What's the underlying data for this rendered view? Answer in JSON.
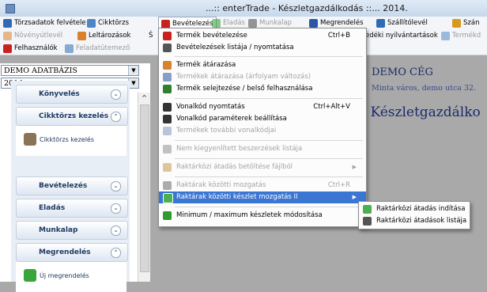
{
  "window": {
    "title": "...:: enterTrade - Készletgazdálkodás ::... 2014."
  },
  "menubar": {
    "row1": [
      {
        "label": "Törzsadatok felvétele",
        "icon": "database-icon",
        "color": "#2d6bb5",
        "disabled": false
      },
      {
        "label": "Cikktörzs",
        "icon": "list-icon",
        "color": "#4f86c6",
        "disabled": false
      },
      {
        "label": "Bevételezés",
        "icon": "inbound-arrow-icon",
        "color": "#c8221f",
        "disabled": false,
        "active": true
      },
      {
        "label": "Eladás",
        "icon": "outbound-arrow-icon",
        "color": "#2f9a2f",
        "disabled": true
      },
      {
        "label": "Munkalap",
        "icon": "hammer-icon",
        "color": "#444444",
        "disabled": true
      },
      {
        "label": "Megrendelés",
        "icon": "order-icon",
        "color": "#2b58a6",
        "disabled": false
      },
      {
        "label": "Szállítólevél",
        "icon": "delivery-note-icon",
        "color": "#2d6bb5",
        "disabled": false
      },
      {
        "label": "Szán",
        "icon": "invoice-icon",
        "color": "#d69a1e",
        "disabled": false
      }
    ],
    "row2": [
      {
        "label": "Növényútlevél",
        "icon": "leaf-icon",
        "color": "#d9812d",
        "disabled": true
      },
      {
        "label": "Leltározások",
        "icon": "inventory-icon",
        "color": "#d9812d",
        "disabled": false
      },
      {
        "label": "Ś",
        "icon": "",
        "color": "#444444",
        "disabled": false
      },
      {
        "label": "edéki nyilvántartások",
        "icon": "",
        "color": "#444444",
        "disabled": false
      },
      {
        "label": "Termékd",
        "icon": "product-icon",
        "color": "#4f86c6",
        "disabled": true
      }
    ],
    "row3": [
      {
        "label": "Felhasználók",
        "icon": "user-icon",
        "color": "#c8221f",
        "disabled": false
      },
      {
        "label": "Feladatütemező",
        "icon": "scheduler-icon",
        "color": "#2d6bb5",
        "disabled": true
      }
    ]
  },
  "left": {
    "database_select": "DEMO ADATBÁZIS",
    "year_select": "2014"
  },
  "nav": {
    "sections": [
      {
        "label": "Könyvelés",
        "expanded": false
      },
      {
        "label": "Cikktörzs kezelés",
        "expanded": true,
        "item": "Cikktörzs kezelés"
      },
      {
        "label": "Bevételezés",
        "expanded": false
      },
      {
        "label": "Eladás",
        "expanded": false
      },
      {
        "label": "Munkalap",
        "expanded": false
      },
      {
        "label": "Megrendelés",
        "expanded": true,
        "item": "Új megrendelés"
      }
    ]
  },
  "content": {
    "company": "DEMO CÉG",
    "address": "Minta város, demo utca 32.",
    "heading": "e Készletgazdálko"
  },
  "dropdown": {
    "items": [
      {
        "label": "Termék bevételezése",
        "shortcut": "Ctrl+B",
        "icon": "inbound-arrow-icon",
        "color": "#c8221f",
        "disabled": false
      },
      {
        "label": "Bevételezések listája / nyomtatása",
        "shortcut": "",
        "icon": "print-list-icon",
        "color": "#555555",
        "disabled": false
      },
      {
        "label": "Termék átárazása",
        "shortcut": "",
        "icon": "price-tag-icon",
        "color": "#d9812d",
        "disabled": false
      },
      {
        "label": "Termékek átárazása (árfolyam változás)",
        "shortcut": "",
        "icon": "currency-icon",
        "color": "#3a5fa8",
        "disabled": true
      },
      {
        "label": "Termék selejtezése / belső felhasználása",
        "shortcut": "",
        "icon": "discard-icon",
        "color": "#2f7f2f",
        "disabled": false
      },
      {
        "label": "Vonalkód nyomtatás",
        "shortcut": "Ctrl+Alt+V",
        "icon": "barcode-print-icon",
        "color": "#333333",
        "disabled": false
      },
      {
        "label": "Vonalkód paraméterek beállítása",
        "shortcut": "",
        "icon": "barcode-settings-icon",
        "color": "#333333",
        "disabled": false
      },
      {
        "label": "Termékek további vonalkódjai",
        "shortcut": "",
        "icon": "barcode-list-icon",
        "color": "#8aa0bf",
        "disabled": true
      },
      {
        "label": "Nem kiegyenlített beszerzések listája",
        "shortcut": "",
        "icon": "unpaid-list-icon",
        "color": "#9a9a9a",
        "disabled": true
      },
      {
        "label": "Raktárközi átadás betöltése fájlból",
        "shortcut": "",
        "icon": "file-load-icon",
        "color": "#c9a15a",
        "disabled": true,
        "submenu": true
      },
      {
        "label": "Raktárak közötti mozgatás",
        "shortcut": "Ctrl+R",
        "icon": "move-icon",
        "color": "#777777",
        "disabled": true
      },
      {
        "label": "Raktárak közötti  készlet mozgatás II",
        "shortcut": "",
        "icon": "move-stock-icon",
        "color": "#4caf50",
        "disabled": false,
        "highlighted": true,
        "submenu": true
      },
      {
        "label": "Minimum / maximum készletek módosítása",
        "shortcut": "",
        "icon": "min-max-icon",
        "color": "#2f9a2f",
        "disabled": false
      }
    ]
  },
  "submenu": {
    "items": [
      {
        "label": "Raktárközi átadás indítása",
        "icon": "start-transfer-icon",
        "color": "#4caf50"
      },
      {
        "label": "Raktárközi átadások listája",
        "icon": "transfer-list-icon",
        "color": "#555555"
      }
    ]
  }
}
